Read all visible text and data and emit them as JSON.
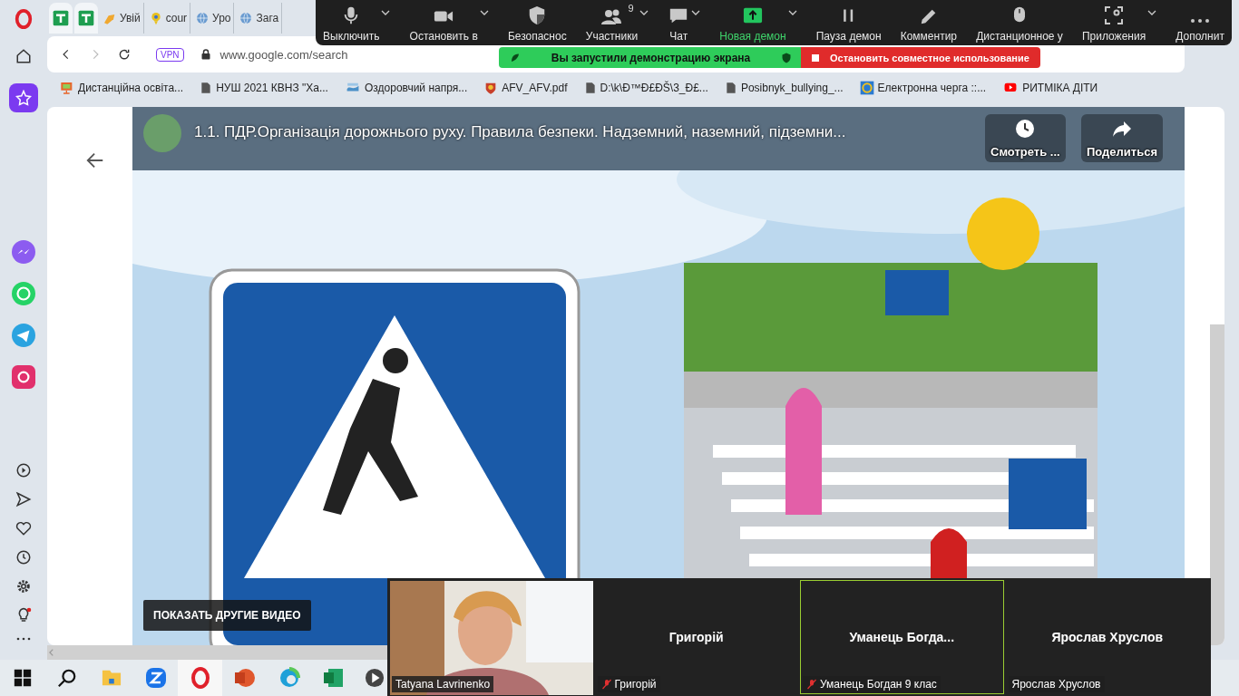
{
  "browser": {
    "tabs": [
      {
        "kind": "sheets",
        "selected": true
      },
      {
        "kind": "sheets",
        "selected": true
      },
      {
        "kind": "hand",
        "label": "Увій",
        "selected": false
      },
      {
        "kind": "pin",
        "label": "cour",
        "selected": false
      },
      {
        "kind": "globe",
        "label": "Уро",
        "selected": false
      },
      {
        "kind": "globe",
        "label": "Зага",
        "selected": false
      }
    ],
    "vpn": "VPN",
    "address": "www.google.com/search",
    "bookmarks": [
      {
        "kind": "monitor",
        "label": "Дистанційна освіта..."
      },
      {
        "kind": "file",
        "label": "НУШ 2021 КВНЗ \"Ха..."
      },
      {
        "kind": "logo",
        "label": "Оздоровчий напря..."
      },
      {
        "kind": "crest",
        "label": "AFV_AFV.pdf"
      },
      {
        "kind": "file",
        "label": "D:\\k\\Đ™Đ£ĐŠ\\3_Đ£..."
      },
      {
        "kind": "file",
        "label": "Posibnyk_bullying_..."
      },
      {
        "kind": "ring",
        "label": "Електронна черга ::..."
      },
      {
        "kind": "youtube",
        "label": "РИТМІКА ДІТИ"
      }
    ]
  },
  "video": {
    "title": "1.1. ПДР.Організація дорожнього руху. Правила безпеки. Надземний, наземний, підземни...",
    "watch_later": "Смотреть ...",
    "share": "Поделиться",
    "more_videos": "ПОКАЗАТЬ ДРУГИЕ ВИДЕО"
  },
  "zoom_toolbar": {
    "buttons": [
      {
        "kind": "mic",
        "label": "Выключить",
        "caret": true,
        "highlighted": false
      },
      {
        "kind": "camera",
        "label": "Остановить в",
        "caret": true,
        "highlighted": false
      },
      {
        "kind": "shield",
        "label": "Безопаснос",
        "caret": false,
        "highlighted": false
      },
      {
        "kind": "people",
        "label": "Участники",
        "badge": "9",
        "caret": true,
        "highlighted": false
      },
      {
        "kind": "chat",
        "label": "Чат",
        "caret": true,
        "highlighted": false
      },
      {
        "kind": "share",
        "label": "Новая демон",
        "caret": true,
        "highlighted": true
      },
      {
        "kind": "pause",
        "label": "Пауза демон",
        "caret": false,
        "highlighted": false
      },
      {
        "kind": "pencil",
        "label": "Комментир",
        "caret": false,
        "highlighted": false
      },
      {
        "kind": "mouse",
        "label": "Дистанционное у",
        "caret": false,
        "highlighted": false
      },
      {
        "kind": "apps",
        "label": "Приложения",
        "caret": true,
        "highlighted": false
      },
      {
        "kind": "more",
        "label": "Дополнит",
        "caret": false,
        "highlighted": false
      }
    ]
  },
  "share_banner": {
    "status": "Вы запустили демонстрацию экрана",
    "stop": "Остановить совместное использование"
  },
  "participants": [
    {
      "kind": "video",
      "label": "Tatyana Lavrinenko",
      "muted": false,
      "speaking": false
    },
    {
      "kind": "name",
      "name": "Григорій",
      "label": "Григорій",
      "muted": true,
      "speaking": false
    },
    {
      "kind": "name",
      "name": "Уманець  Богда...",
      "label": "Уманець Богдан 9 клас",
      "muted": true,
      "speaking": true
    },
    {
      "kind": "name",
      "name": "Ярослав Хруслов",
      "label": "Ярослав Хруслов",
      "muted": false,
      "speaking": false
    }
  ]
}
